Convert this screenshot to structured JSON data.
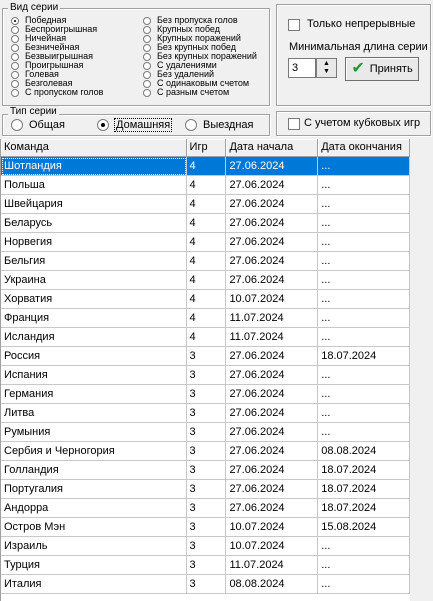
{
  "series_kind": {
    "title": "Вид серии",
    "left": [
      {
        "label": "Победная",
        "checked": true
      },
      {
        "label": "Беспроигрышная",
        "checked": false
      },
      {
        "label": "Ничейная",
        "checked": false
      },
      {
        "label": "Безничейная",
        "checked": false
      },
      {
        "label": "Безвыигрышная",
        "checked": false
      },
      {
        "label": "Проигрышная",
        "checked": false
      },
      {
        "label": "Голевая",
        "checked": false
      },
      {
        "label": "Безголевая",
        "checked": false
      },
      {
        "label": "С пропуском голов",
        "checked": false
      }
    ],
    "right": [
      {
        "label": "Без пропуска голов",
        "checked": false
      },
      {
        "label": "Крупных побед",
        "checked": false
      },
      {
        "label": "Крупных поражений",
        "checked": false
      },
      {
        "label": "Без крупных побед",
        "checked": false
      },
      {
        "label": "Без крупных поражений",
        "checked": false
      },
      {
        "label": "С удалениями",
        "checked": false
      },
      {
        "label": "Без удалений",
        "checked": false
      },
      {
        "label": "С одинаковым счетом",
        "checked": false
      },
      {
        "label": "С разным счетом",
        "checked": false
      }
    ]
  },
  "options": {
    "continuous_label": "Только непрерывные",
    "continuous_checked": false,
    "min_length_label": "Минимальная длина серии",
    "min_length_value": "3",
    "accept_label": "Принять",
    "cup_label": "С учетом кубковых игр",
    "cup_checked": false
  },
  "series_type": {
    "title": "Тип серии",
    "options": [
      {
        "label": "Общая",
        "checked": false
      },
      {
        "label": "Домашняя",
        "checked": true
      },
      {
        "label": "Выездная",
        "checked": false
      }
    ]
  },
  "table": {
    "headers": [
      "Команда",
      "Игр",
      "Дата начала",
      "Дата окончания"
    ],
    "selected_index": 0,
    "rows": [
      [
        "Шотландия",
        "4",
        "27.06.2024",
        "..."
      ],
      [
        "Польша",
        "4",
        "27.06.2024",
        "..."
      ],
      [
        "Швейцария",
        "4",
        "27.06.2024",
        "..."
      ],
      [
        "Беларусь",
        "4",
        "27.06.2024",
        "..."
      ],
      [
        "Норвегия",
        "4",
        "27.06.2024",
        "..."
      ],
      [
        "Бельгия",
        "4",
        "27.06.2024",
        "..."
      ],
      [
        "Украина",
        "4",
        "27.06.2024",
        "..."
      ],
      [
        "Хорватия",
        "4",
        "10.07.2024",
        "..."
      ],
      [
        "Франция",
        "4",
        "11.07.2024",
        "..."
      ],
      [
        "Исландия",
        "4",
        "11.07.2024",
        "..."
      ],
      [
        "Россия",
        "3",
        "27.06.2024",
        "18.07.2024"
      ],
      [
        "Испания",
        "3",
        "27.06.2024",
        "..."
      ],
      [
        "Германия",
        "3",
        "27.06.2024",
        "..."
      ],
      [
        "Литва",
        "3",
        "27.06.2024",
        "..."
      ],
      [
        "Румыния",
        "3",
        "27.06.2024",
        "..."
      ],
      [
        "Сербия и Черногория",
        "3",
        "27.06.2024",
        "08.08.2024"
      ],
      [
        "Голландия",
        "3",
        "27.06.2024",
        "18.07.2024"
      ],
      [
        "Португалия",
        "3",
        "27.06.2024",
        "18.07.2024"
      ],
      [
        "Андорра",
        "3",
        "27.06.2024",
        "18.07.2024"
      ],
      [
        "Остров Мэн",
        "3",
        "10.07.2024",
        "15.08.2024"
      ],
      [
        "Израиль",
        "3",
        "10.07.2024",
        "..."
      ],
      [
        "Турция",
        "3",
        "11.07.2024",
        "..."
      ],
      [
        "Италия",
        "3",
        "08.08.2024",
        "..."
      ]
    ]
  }
}
